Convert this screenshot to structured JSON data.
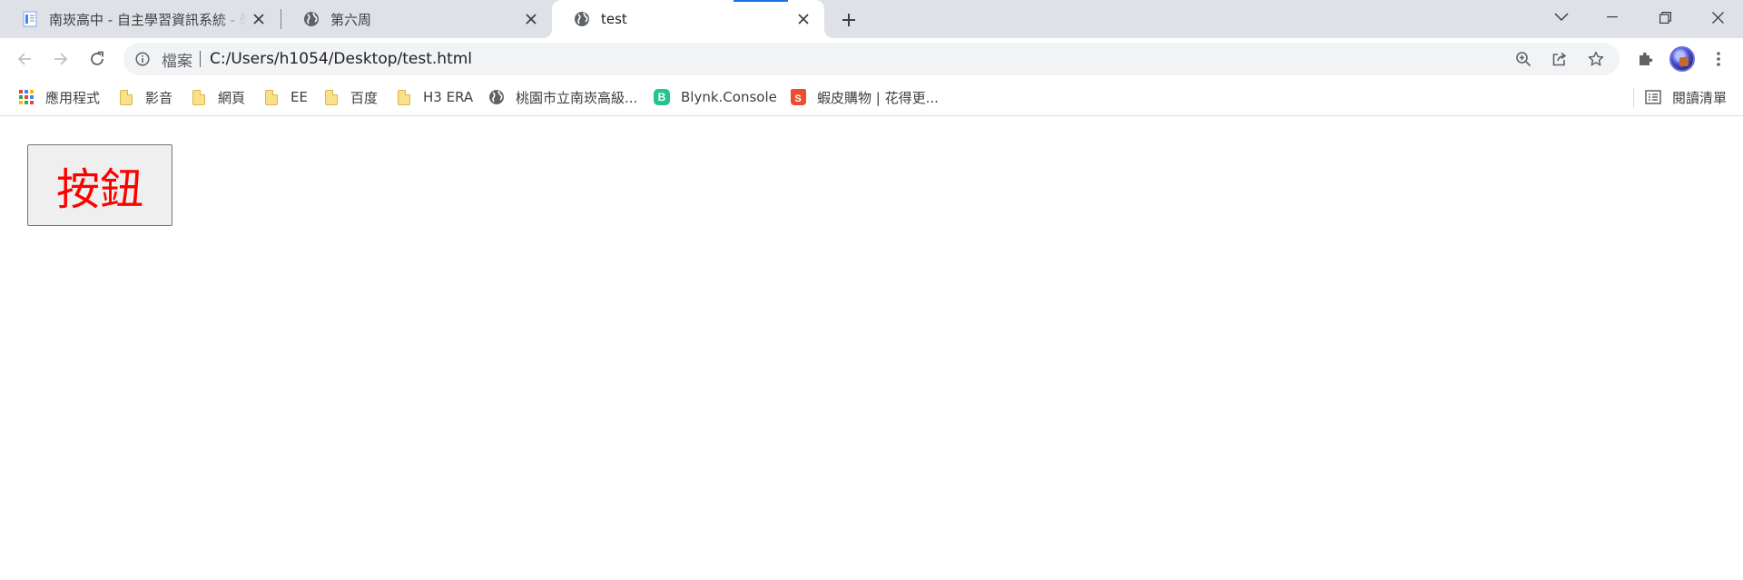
{
  "tabs": [
    {
      "title": "南崁高中 - 自主學習資訊系統 - 學",
      "favicon": "doc-icon"
    },
    {
      "title": "第六周",
      "favicon": "globe-icon"
    },
    {
      "title": "test",
      "favicon": "globe-icon",
      "active": true
    }
  ],
  "omnibox": {
    "scheme_label": "檔案",
    "url": "C:/Users/h1054/Desktop/test.html"
  },
  "bookmarks": [
    {
      "label": "應用程式",
      "icon": "apps-grid-icon"
    },
    {
      "label": "影音",
      "icon": "folder-icon"
    },
    {
      "label": "網頁",
      "icon": "folder-icon"
    },
    {
      "label": "EE",
      "icon": "folder-icon"
    },
    {
      "label": "百度",
      "icon": "folder-icon"
    },
    {
      "label": "H3 ERA",
      "icon": "folder-icon"
    },
    {
      "label": "桃園市立南崁高級...",
      "icon": "globe-icon"
    },
    {
      "label": "Blynk.Console",
      "icon": "blynk-icon",
      "icon_text": "B"
    },
    {
      "label": "蝦皮購物 | 花得更...",
      "icon": "shopee-icon",
      "icon_text": "S"
    }
  ],
  "reading_list": {
    "label": "閱讀清單"
  },
  "page": {
    "button_label": "按鈕",
    "button_text_color": "#ff0000"
  },
  "colors": {
    "tabstrip_bg": "#dee1e6",
    "omnibox_bg": "#f1f3f4",
    "accent": "#1a73e8"
  }
}
